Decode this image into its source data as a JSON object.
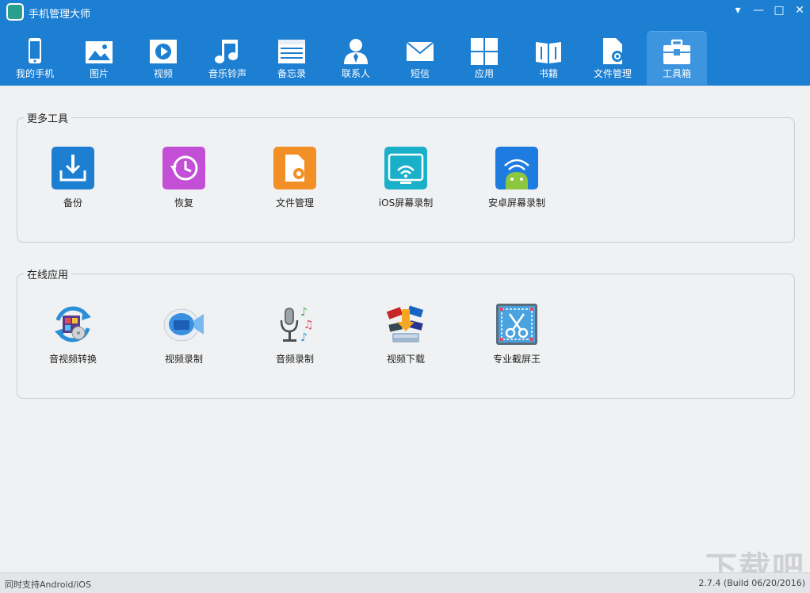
{
  "window": {
    "title": "手机管理大师",
    "controls": {
      "menu": "▾",
      "minimize": "—",
      "maximize": "□",
      "close": "✕"
    }
  },
  "nav": [
    {
      "label": "我的手机",
      "icon": "phone-icon"
    },
    {
      "label": "图片",
      "icon": "picture-icon"
    },
    {
      "label": "视频",
      "icon": "video-icon"
    },
    {
      "label": "音乐铃声",
      "icon": "music-icon"
    },
    {
      "label": "备忘录",
      "icon": "memo-icon"
    },
    {
      "label": "联系人",
      "icon": "contacts-icon"
    },
    {
      "label": "短信",
      "icon": "sms-icon"
    },
    {
      "label": "应用",
      "icon": "apps-icon"
    },
    {
      "label": "书籍",
      "icon": "books-icon"
    },
    {
      "label": "文件管理",
      "icon": "file-manager-icon"
    },
    {
      "label": "工具箱",
      "icon": "toolbox-icon",
      "active": true
    }
  ],
  "groups": [
    {
      "title": "更多工具",
      "tools": [
        {
          "label": "备份",
          "icon": "backup-icon",
          "color": "#1d7fd2"
        },
        {
          "label": "恢复",
          "icon": "restore-icon",
          "color": "#c24fd6"
        },
        {
          "label": "文件管理",
          "icon": "file-manager-icon",
          "color": "#f29027"
        },
        {
          "label": "iOS屏幕录制",
          "icon": "ios-screen-record-icon",
          "color": "#1ab0c9"
        },
        {
          "label": "安卓屏幕录制",
          "icon": "android-screen-record-icon",
          "color": "#1e7be0"
        }
      ]
    },
    {
      "title": "在线应用",
      "tools": [
        {
          "label": "音视频转换",
          "icon": "av-convert-icon"
        },
        {
          "label": "视频录制",
          "icon": "video-record-icon"
        },
        {
          "label": "音频录制",
          "icon": "audio-record-icon"
        },
        {
          "label": "视频下载",
          "icon": "video-download-icon"
        },
        {
          "label": "专业截屏王",
          "icon": "screenshot-icon"
        }
      ]
    }
  ],
  "status": {
    "left": "同时支持Android/iOS",
    "right": "2.7.4 (Build 06/20/2016)"
  },
  "watermark": "下载吧"
}
